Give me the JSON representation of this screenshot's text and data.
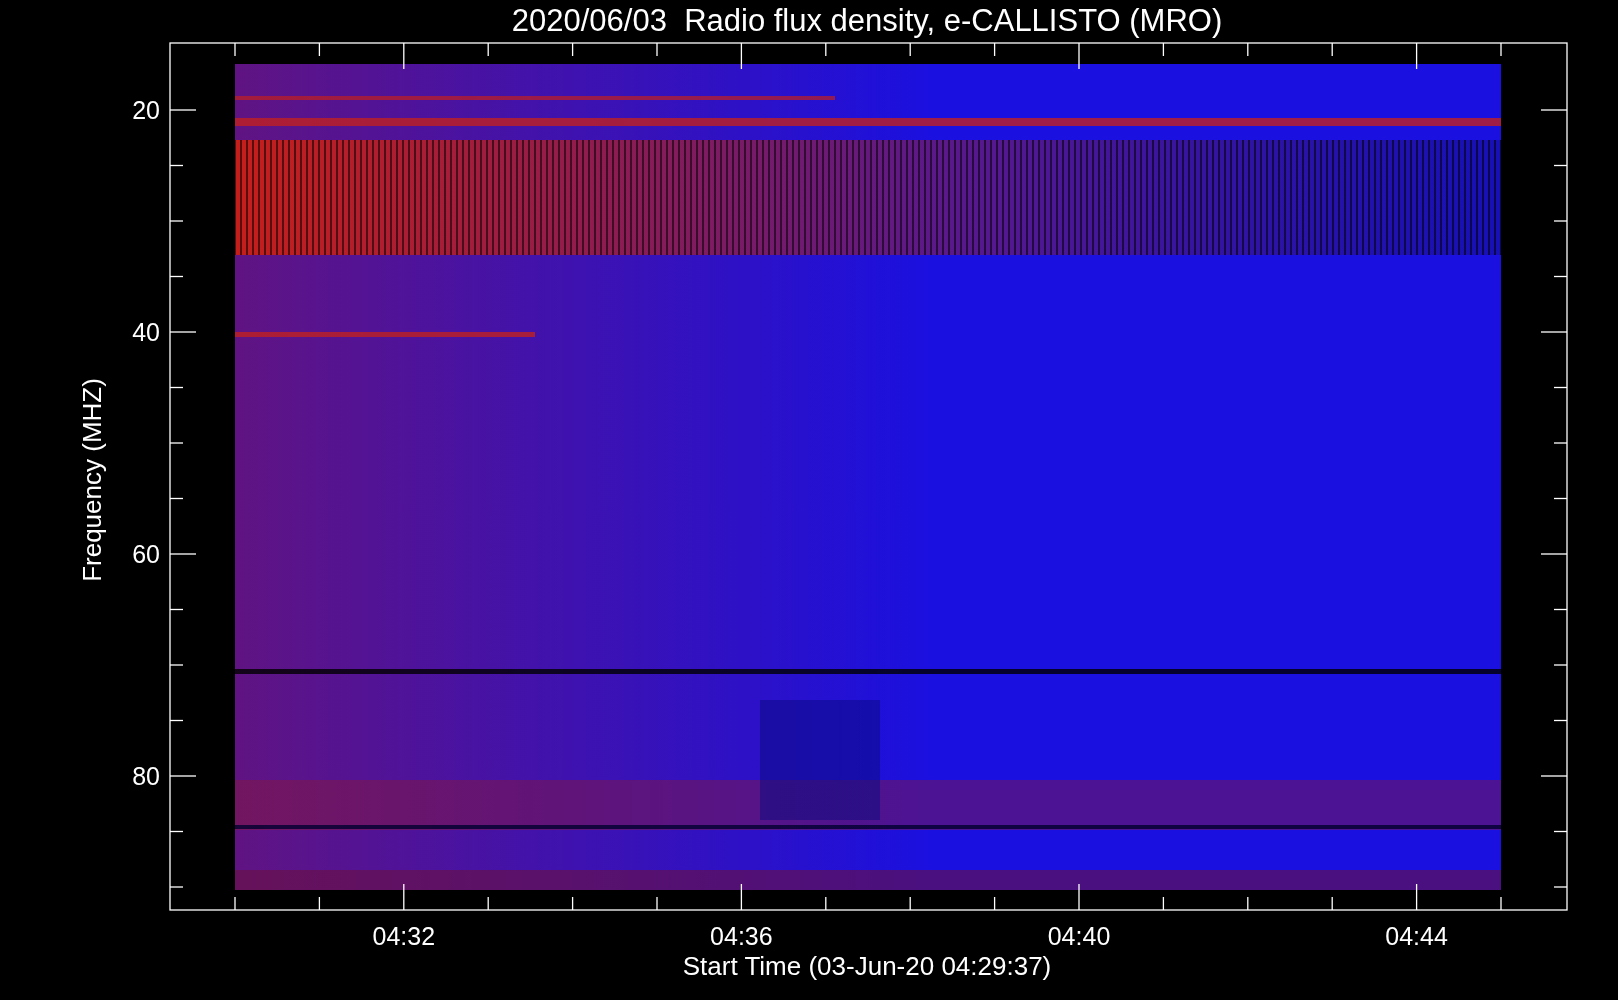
{
  "title": "2020/06/03  Radio flux density, e-CALLISTO (MRO)",
  "y_axis": {
    "label": "Frequency (MHZ)",
    "ticks": [
      "20",
      "40",
      "60",
      "80"
    ]
  },
  "x_axis": {
    "label": "Start Time (03-Jun-20 04:29:37)",
    "ticks": [
      "04:32",
      "04:36",
      "04:40",
      "04:44"
    ]
  }
}
